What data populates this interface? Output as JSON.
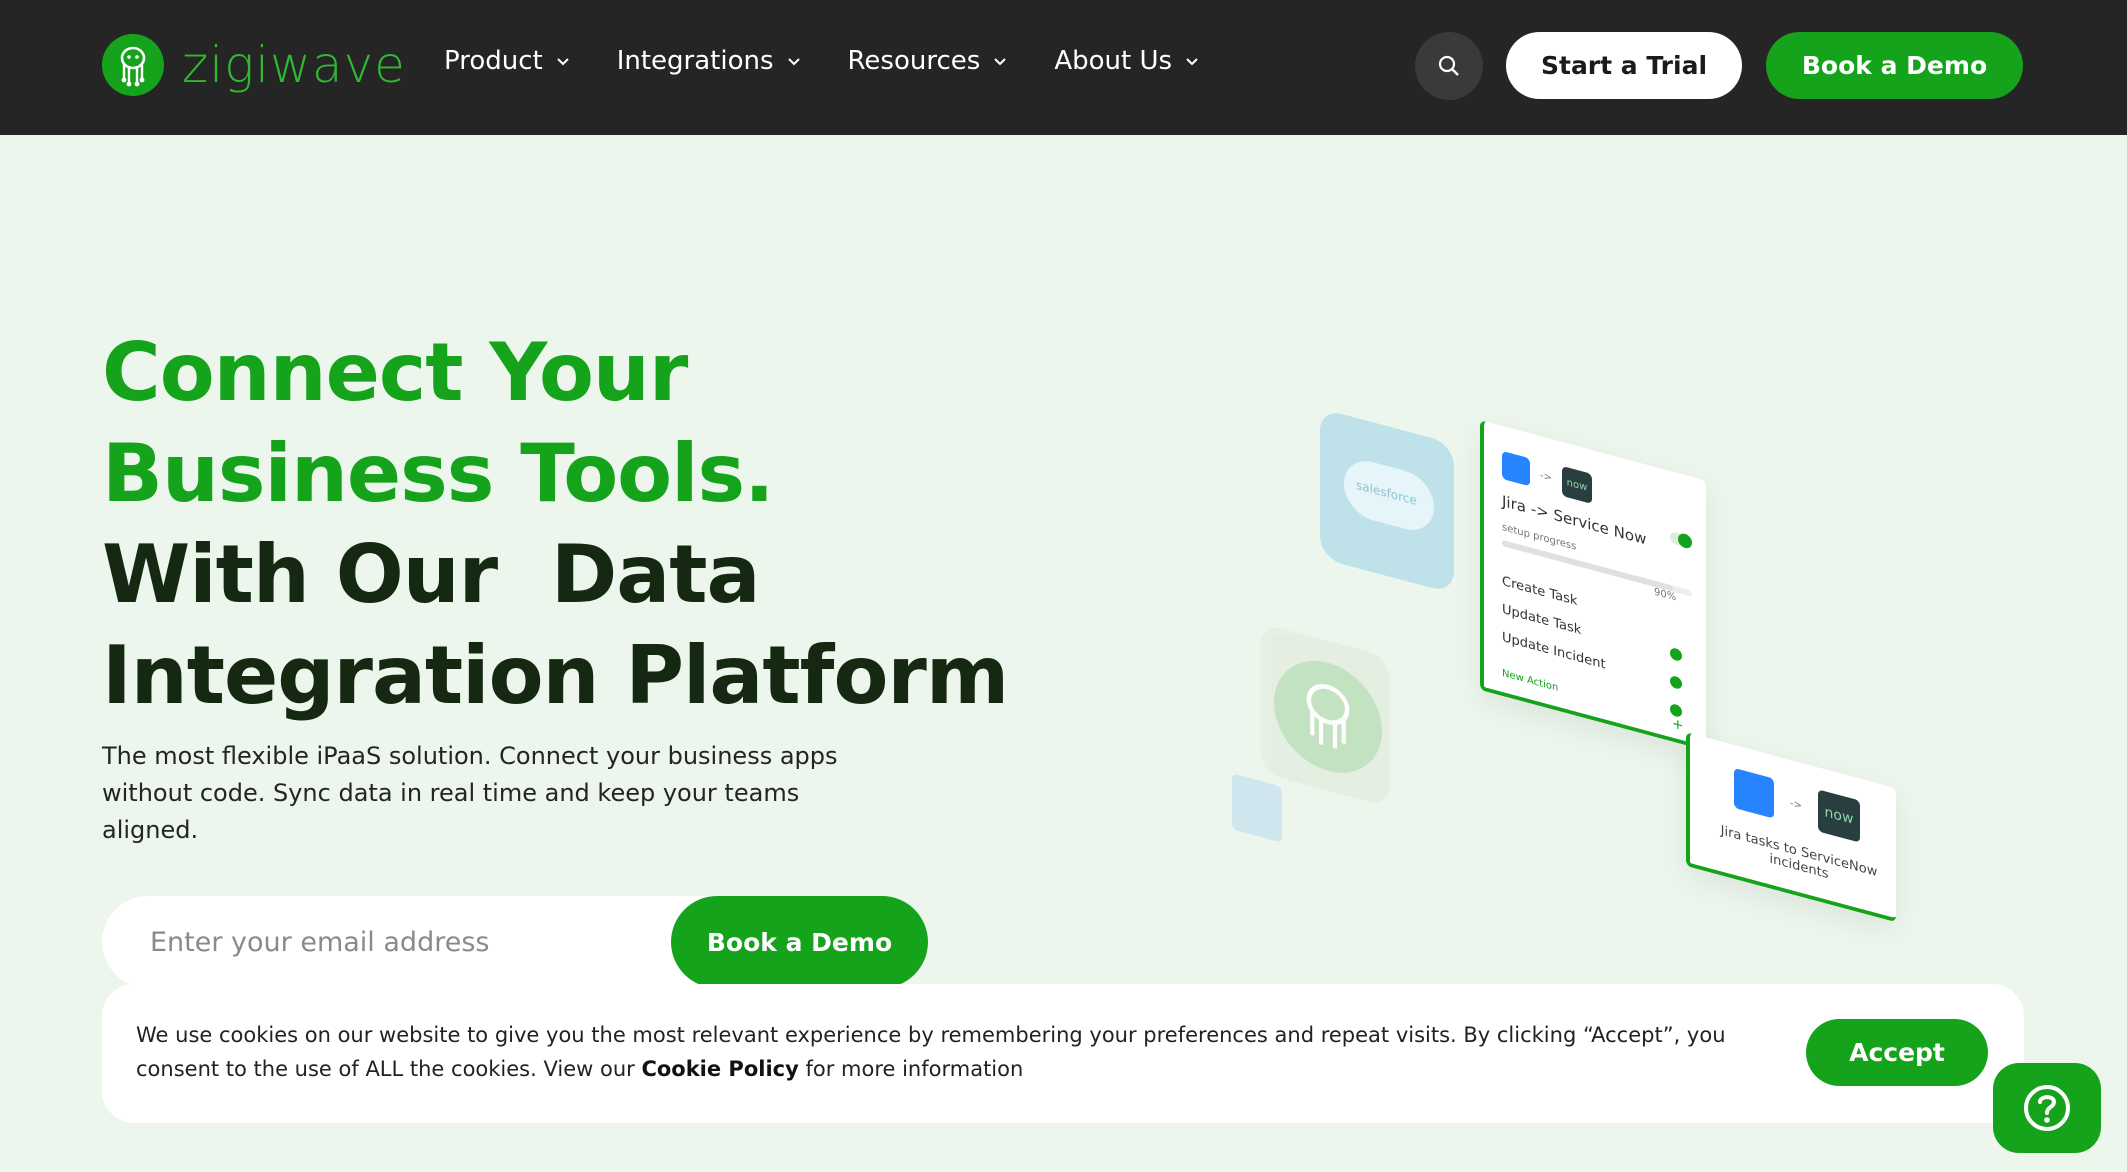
{
  "brand": {
    "name": "zigiwave",
    "accent": "#16a31c",
    "nav_bg": "#252525",
    "page_bg": "#edf6ec"
  },
  "nav": {
    "items": [
      {
        "label": "Product"
      },
      {
        "label": "Integrations"
      },
      {
        "label": "Resources"
      },
      {
        "label": "About Us"
      }
    ],
    "search_icon": "search-icon",
    "trial_label": "Start a Trial",
    "demo_label": "Book a Demo"
  },
  "hero": {
    "title_line1": "Connect Your",
    "title_line2": "Business Tools.",
    "title_line3": "With Our  Data",
    "title_line4": "Integration Platform",
    "subtitle": "The most flexible iPaaS solution. Connect your business apps without code. Sync data in real time and keep your teams aligned.",
    "email_placeholder": "Enter your email address",
    "demo_label": "Book a Demo"
  },
  "illustration": {
    "salesforce_label": "salesforce",
    "card_main": {
      "arrow": "->",
      "now_label": "now",
      "title": "Jira -> Service Now",
      "setup_label": "setup progress",
      "setup_pct": "90%",
      "setup_progress": 0.9,
      "actions": [
        "Create Task",
        "Update Task",
        "Update Incident"
      ],
      "new_action": "New Action",
      "plus": "+"
    },
    "card_small": {
      "arrow": "->",
      "now_label": "now",
      "desc": "Jira tasks to ServiceNow incidents"
    }
  },
  "cookie": {
    "text_before": "We use cookies on our website to give you the most relevant experience by remembering your preferences and repeat visits. By clicking “Accept”, you consent to the use of ALL the cookies. View our ",
    "policy_link": "Cookie Policy",
    "text_after": " for more information",
    "accept_label": "Accept"
  },
  "help": {
    "icon": "help-question-icon"
  }
}
